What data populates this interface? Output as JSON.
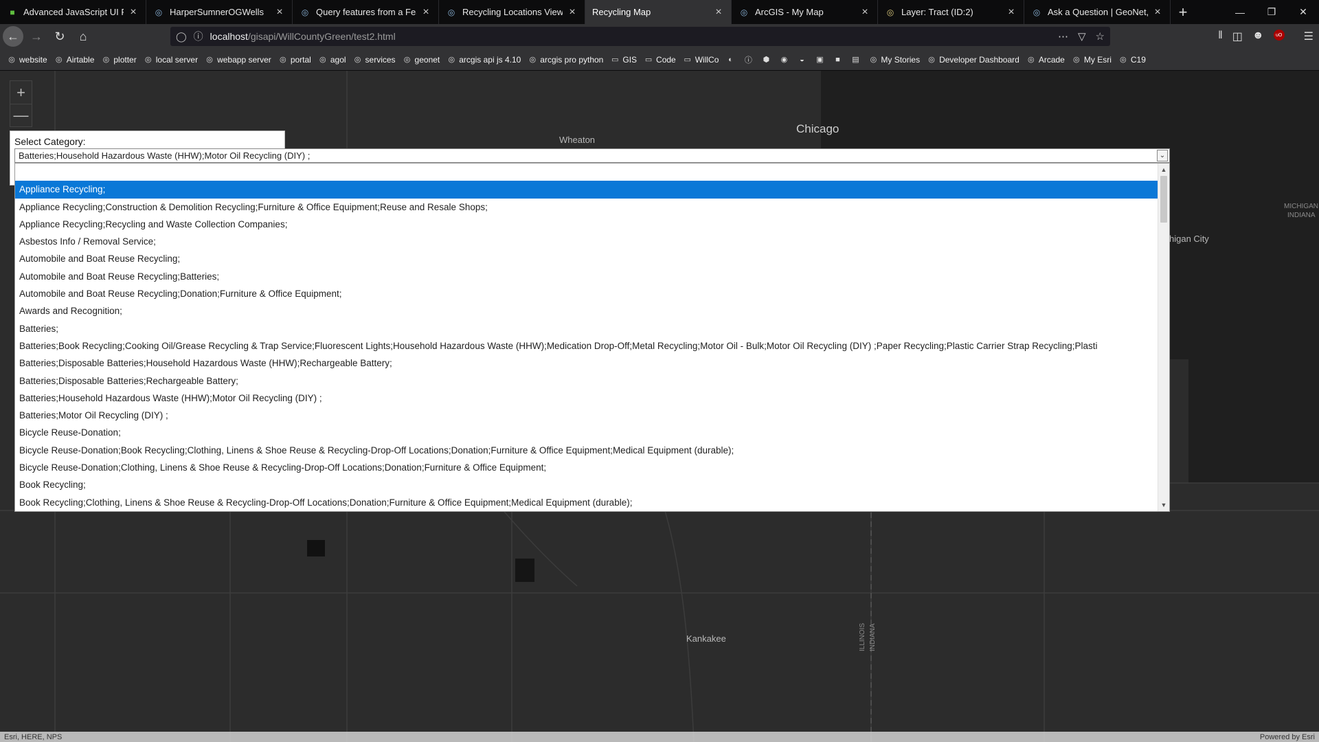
{
  "browser": {
    "tabs": [
      {
        "title": "Advanced JavaScript UI Fram",
        "icon": "green-square-icon",
        "color": "#5fbf3f"
      },
      {
        "title": "HarperSumnerOGWells",
        "icon": "arcgis-globe-icon",
        "color": "#8ab4d9"
      },
      {
        "title": "Query features from a Featu",
        "icon": "arcgis-globe-icon",
        "color": "#8ab4d9"
      },
      {
        "title": "Recycling Locations View",
        "icon": "arcgis-globe-icon",
        "color": "#8ab4d9"
      },
      {
        "title": "Recycling Map",
        "icon": "",
        "color": ""
      },
      {
        "title": "ArcGIS - My Map",
        "icon": "arcgis-globe-icon",
        "color": "#8ab4d9"
      },
      {
        "title": "Layer: Tract (ID:2)",
        "icon": "arcgis-server-icon",
        "color": "#d9c77a"
      },
      {
        "title": "Ask a Question | GeoNet, The",
        "icon": "geonet-icon",
        "color": "#8ab4d9"
      }
    ],
    "active_tab_index": 4,
    "new_tab": "+",
    "url_host": "localhost",
    "url_path": "/gisapi/WillCountyGreen/test2.html",
    "bookmarks": [
      "website",
      "Airtable",
      "plotter",
      "local server",
      "webapp server",
      "portal",
      "agol",
      "services",
      "geonet",
      "arcgis api js 4.10",
      "arcgis pro python",
      "GIS",
      "Code",
      "WillCo",
      "My Stories",
      "Developer Dashboard",
      "Arcade",
      "My Esri",
      "C19"
    ]
  },
  "map": {
    "labels": {
      "chicago": "Chicago",
      "wheaton": "Wheaton",
      "kankakee": "Kankakee",
      "michigan_city": "higan City",
      "michigan_indiana_1": "MICHIGAN",
      "michigan_indiana_2": "INDIANA",
      "illinois": "ILLINOIS",
      "indiana": "INDIANA"
    },
    "zoom_in": "+",
    "zoom_out": "—",
    "attribution_left": "Esri, HERE, NPS",
    "attribution_right": "Powered by Esri"
  },
  "category": {
    "label": "Select Category:",
    "selected_value": "Batteries;Household Hazardous Waste (HHW);Motor Oil Recycling (DIY) ;",
    "highlighted_option": "Appliance Recycling;",
    "options": [
      "",
      "Appliance Recycling;",
      "Appliance Recycling;Construction & Demolition Recycling;Furniture & Office Equipment;Reuse and Resale Shops;",
      "Appliance Recycling;Recycling and Waste Collection Companies;",
      "Asbestos Info / Removal Service;",
      "Automobile and Boat Reuse Recycling;",
      "Automobile and Boat Reuse Recycling;Batteries;",
      "Automobile and Boat Reuse Recycling;Donation;Furniture & Office Equipment;",
      "Awards and Recognition;",
      "Batteries;",
      "Batteries;Book Recycling;Cooking Oil/Grease Recycling & Trap Service;Fluorescent Lights;Household Hazardous Waste (HHW);Medication Drop-Off;Metal Recycling;Motor Oil - Bulk;Motor Oil Recycling (DIY) ;Paper Recycling;Plastic Carrier Strap Recycling;Plasti",
      "Batteries;Disposable Batteries;Household Hazardous Waste (HHW);Rechargeable Battery;",
      "Batteries;Disposable Batteries;Rechargeable Battery;",
      "Batteries;Household Hazardous Waste (HHW);Motor Oil Recycling (DIY) ;",
      "Batteries;Motor Oil Recycling (DIY) ;",
      "Bicycle Reuse-Donation;",
      "Bicycle Reuse-Donation;Book Recycling;Clothing, Linens & Shoe Reuse & Recycling-Drop-Off Locations;Donation;Furniture & Office Equipment;Medical Equipment (durable);",
      "Bicycle Reuse-Donation;Clothing, Linens & Shoe Reuse & Recycling-Drop-Off Locations;Donation;Furniture & Office Equipment;",
      "Book Recycling;",
      "Book Recycling;Clothing, Linens & Shoe Reuse & Recycling-Drop-Off Locations;Donation;Furniture & Office Equipment;Medical Equipment (durable);"
    ]
  },
  "colors": {
    "selection": "#0a78d7",
    "map_land": "#2c2c2c",
    "map_water": "#1f1f1f"
  }
}
